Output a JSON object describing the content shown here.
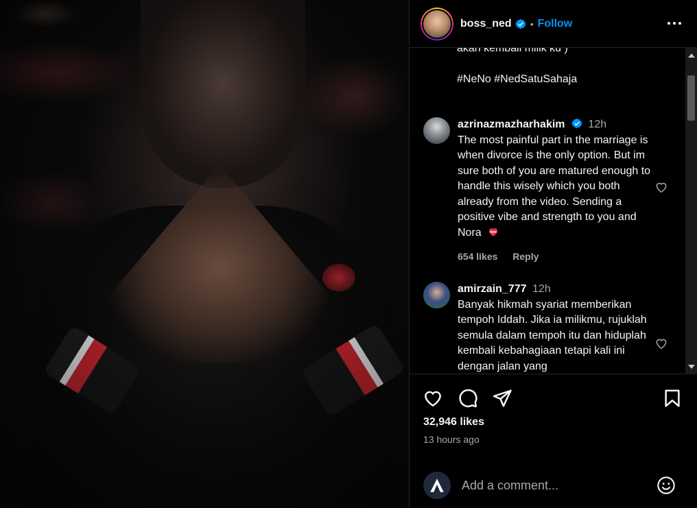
{
  "post": {
    "username": "boss_ned",
    "follow_label": "Follow",
    "dot": "•"
  },
  "caption_tail": {
    "line1": "akan kembali milik ku )",
    "hashtags": "#NeNo #NedSatuSahaja"
  },
  "comments": [
    {
      "username": "azrinazmazharhakim",
      "verified": true,
      "time": "12h",
      "text": "The most painful part in the marriage is when divorce is the only option. But im sure both of you are matured enough to handle this wisely which you both already from the video. Sending a positive vibe and strength to you and Nora",
      "emoji": "heart-icon",
      "likes": "654 likes",
      "reply_label": "Reply"
    },
    {
      "username": "amirzain_777",
      "verified": false,
      "time": "12h",
      "text": "Banyak hikmah syariat memberikan tempoh Iddah. Jika ia milikmu, rujuklah semula dalam tempoh itu dan hiduplah kembali kebahagiaan tetapi kali ini dengan jalan yang"
    }
  ],
  "stats": {
    "likes": "32,946 likes",
    "time_ago": "13 hours ago"
  },
  "add_comment": {
    "placeholder": "Add a comment..."
  },
  "colors": {
    "accent": "#0095f6",
    "background": "#000000",
    "secondary_text": "#a8a8a8"
  }
}
